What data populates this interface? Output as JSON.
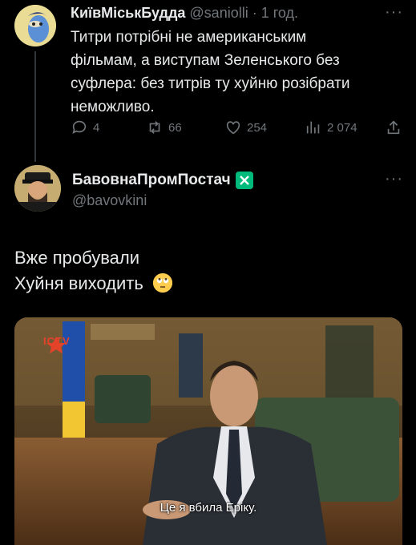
{
  "tweet1": {
    "name": "КиївМіськБудда",
    "meta": "@saniolli · 1 год.",
    "text_lines": [
      "Титри потрібні не американським",
      "фільмам, а виступам Зеленського без",
      "суфлера: без титрів ту хуйню розібрати",
      "неможливо."
    ],
    "more": "···",
    "actions": {
      "reply_count": "4",
      "retweet_count": "66",
      "like_count": "254",
      "views_count": "2 074"
    }
  },
  "tweet2": {
    "name": "БавовнаПромПостач",
    "handle": "@bavovkini",
    "more": "···",
    "text_lines": [
      "Вже пробували",
      "Хуйня виходить"
    ],
    "media": {
      "channel_logo": "ICTV",
      "subtitle": "Це я вбила Еріку."
    }
  },
  "colors": {
    "background": "#000000",
    "text": "#e7e9ea",
    "secondary": "#71767b",
    "verified": "#00ba7c"
  },
  "icons": [
    "reply-icon",
    "retweet-icon",
    "like-icon",
    "views-icon",
    "share-icon",
    "verified-badge-icon",
    "more-icon",
    "eye-roll-emoji"
  ]
}
